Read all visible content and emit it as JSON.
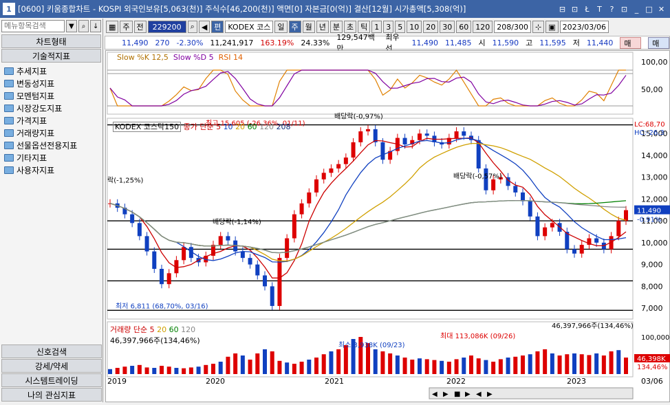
{
  "titlebar": {
    "num": "1",
    "title": "[0600] 키움종합차트 - KOSPI 외국인보유[5,063(천)] 주식수[46,200(천)] 액면[0] 자본금[0(억)] 결산[12월] 시가총액[5,308(억)]",
    "ctrls": [
      "⊟",
      "⊡",
      "Ł",
      "T",
      "?",
      "⊡",
      "_",
      "□",
      "✕"
    ]
  },
  "left": {
    "search_placeholder": "메뉴항목검색",
    "tab1": "차트형태",
    "tab2": "기술적지표",
    "tree": [
      "추세지표",
      "변동성지표",
      "모멘텀지표",
      "시장강도지표",
      "가격지표",
      "거래량지표",
      "선물옵션전용지표",
      "기타지표",
      "사용자지표"
    ],
    "bottom": [
      "신호검색",
      "강세/약세",
      "시스템트레이딩",
      "나의 관심지표"
    ]
  },
  "toolbar": {
    "type": "주",
    "rel": "전",
    "code": "229200",
    "name": "KODEX 코스",
    "periods": [
      "일",
      "주",
      "월",
      "년",
      "분",
      "초",
      "틱"
    ],
    "nums": [
      "1",
      "3",
      "5",
      "10",
      "20",
      "30",
      "60",
      "120"
    ],
    "count": "208/300",
    "date": "2023/03/06"
  },
  "info": {
    "price": "11,490",
    "change": "270",
    "pct": "-2.30%",
    "vol": "11,241,917",
    "vol_pct": "163.19%",
    "turnover": "24.33%",
    "amount": "129,547백만",
    "best_label": "최우선",
    "best_ask": "11,490",
    "best_bid": "11,485",
    "open_label": "시",
    "open": "11,590",
    "high_label": "고",
    "high": "11,595",
    "low_label": "저",
    "low": "11,440",
    "buy": "매수",
    "sell": "매도"
  },
  "stoch_legend": {
    "s1": "Slow %K 12,5",
    "s2": "Slow %D 5",
    "s3": "RSI 14"
  },
  "stoch_axis": [
    "100,00",
    "50,00"
  ],
  "price_legend": {
    "name": "KODEX 코스닥150",
    "ma": "종가 단순",
    "m5": "5",
    "m10": "10",
    "m20": "20",
    "m60": "60",
    "m120": "120",
    "m208": "208"
  },
  "price_axis": [
    "15,000",
    "14,000",
    "13,000",
    "12,000",
    "11,000",
    "10,000",
    "9,000",
    "8,000",
    "7,000"
  ],
  "price_right": {
    "lc": "LC:68,70",
    "hc": "HC:-26,3",
    "cur": "11,490",
    "pct": "-0.91%"
  },
  "annotations": {
    "high": "최고 15,605 (-26,36%, 01/11)",
    "low": "최저 6,811 (68,70%, 03/16)",
    "div1": "배당락(-0,97%)",
    "div2": "배당락(-0,57%)",
    "div3": "배당락(-1,14%)",
    "div4": "락(-1,25%)"
  },
  "vol_legend": {
    "name": "거래량",
    "ma": "단순",
    "m5": "5",
    "m20": "20",
    "m60": "60",
    "m120": "120",
    "val": "46,397,966주(134,46%)"
  },
  "vol_right": {
    "val": "46,397,966주(134,46%)",
    "axis": "100,000",
    "cur": "46,398K",
    "pct": "134,46%"
  },
  "vol_ann": {
    "min": "최소 3,938K (09/23)",
    "max": "최대 113,086K (09/26)"
  },
  "xaxis": [
    "2019",
    "2020",
    "2021",
    "2022",
    "2023",
    "03/06"
  ],
  "chart_data": {
    "type": "line",
    "x_start": "2019",
    "x_end": "2023/03/06",
    "ylim": [
      6500,
      15700
    ],
    "close": [
      11800,
      11600,
      11300,
      10900,
      10300,
      9600,
      8800,
      8100,
      8600,
      9200,
      9800,
      9300,
      9100,
      9400,
      9900,
      10300,
      10100,
      9600,
      9300,
      9000,
      8500,
      8000,
      7100,
      9300,
      10200,
      11300,
      11800,
      12300,
      12900,
      13200,
      13400,
      13600,
      13900,
      14600,
      15100,
      15200,
      14600,
      13800,
      14200,
      14800,
      14500,
      14700,
      15000,
      14900,
      14600,
      14500,
      14800,
      15100,
      14900,
      14700,
      13400,
      12400,
      12900,
      13000,
      12600,
      12300,
      11900,
      11200,
      10300,
      10700,
      10900,
      10500,
      9700,
      9500,
      9900,
      10200,
      10000,
      9700,
      10300,
      11000,
      11490
    ],
    "vol_ratio": [
      0.12,
      0.15,
      0.18,
      0.2,
      0.22,
      0.16,
      0.15,
      0.2,
      0.18,
      0.15,
      0.14,
      0.16,
      0.18,
      0.22,
      0.25,
      0.3,
      0.42,
      0.5,
      0.45,
      0.35,
      0.5,
      0.6,
      0.55,
      0.32,
      0.28,
      0.25,
      0.3,
      0.35,
      0.4,
      0.48,
      0.55,
      0.6,
      0.7,
      0.85,
      0.9,
      0.75,
      0.6,
      0.55,
      0.5,
      0.45,
      0.4,
      0.35,
      0.38,
      0.36,
      0.34,
      0.32,
      0.3,
      0.36,
      0.4,
      0.45,
      0.38,
      0.34,
      0.3,
      0.36,
      0.4,
      0.42,
      0.45,
      0.48,
      0.55,
      0.6,
      0.5,
      0.45,
      0.48,
      0.5,
      0.48,
      0.46,
      0.5,
      0.45,
      0.55,
      0.58,
      0.4
    ]
  }
}
